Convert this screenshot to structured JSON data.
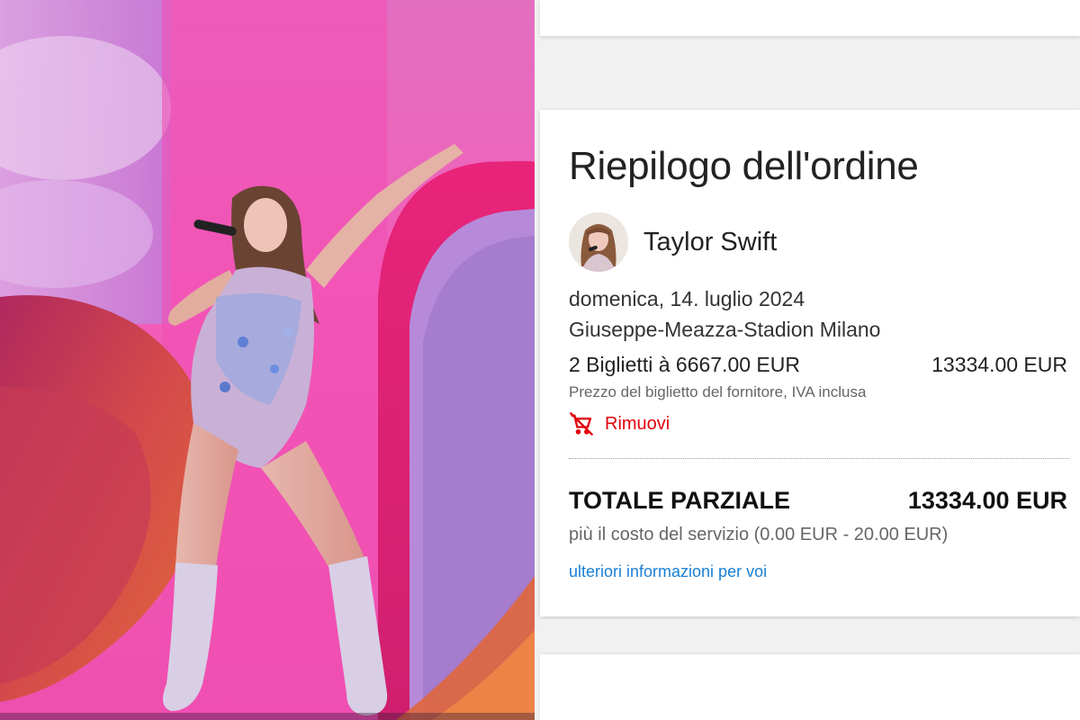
{
  "order_summary": {
    "title": "Riepilogo dell'ordine",
    "artist": "Taylor Swift",
    "date": "domenica, 14. luglio 2024",
    "venue": "Giuseppe-Meazza-Stadion Milano",
    "tickets_line": "2  Biglietti à 6667.00 EUR",
    "tickets_total": "13334.00 EUR",
    "price_note": "Prezzo del biglietto del fornitore, IVA inclusa",
    "remove_label": "Rimuovi",
    "remove_icon": "remove-from-cart-icon",
    "subtotal_label": "TOTALE PARZIALE",
    "subtotal_value": "13334.00 EUR",
    "service_fee": "più il costo del servizio (0.00 EUR - 20.00 EUR)",
    "more_info_link": "ulteriori informazioni per voi"
  },
  "colors": {
    "remove_red": "#e3000b",
    "link_blue": "#1a7fd4",
    "stage_pink": "#f25fb8"
  }
}
